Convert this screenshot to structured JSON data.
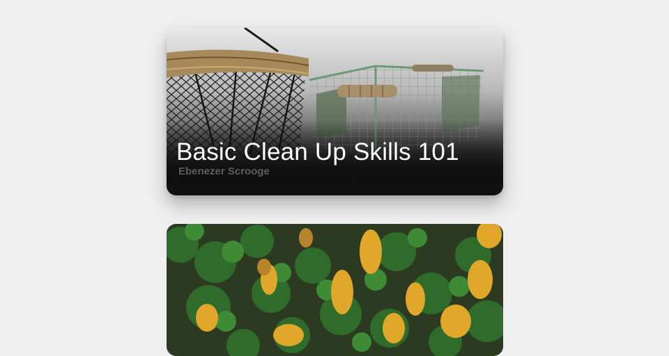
{
  "courses": [
    {
      "title": "Basic Clean Up Skills 101",
      "author": "Ebenezer Scrooge",
      "image": "wire-baskets-photo"
    },
    {
      "title": "",
      "author": "",
      "image": "aerial-forest-photo"
    }
  ]
}
